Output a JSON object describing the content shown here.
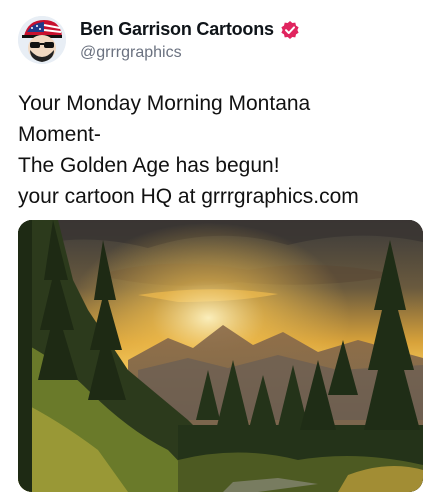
{
  "author": {
    "display_name": "Ben Garrison Cartoons",
    "handle": "@grrrgraphics",
    "verified": true,
    "verified_color": "#e0245e",
    "avatar_icon": "cartoon-avatar-with-flag-hat"
  },
  "post": {
    "lines": [
      "Your Monday Morning Montana",
      "Moment-",
      "The Golden Age has begun!",
      "your cartoon HQ at grrrgraphics.com"
    ],
    "media_icon": "sunset-mountain-forest-photo"
  }
}
